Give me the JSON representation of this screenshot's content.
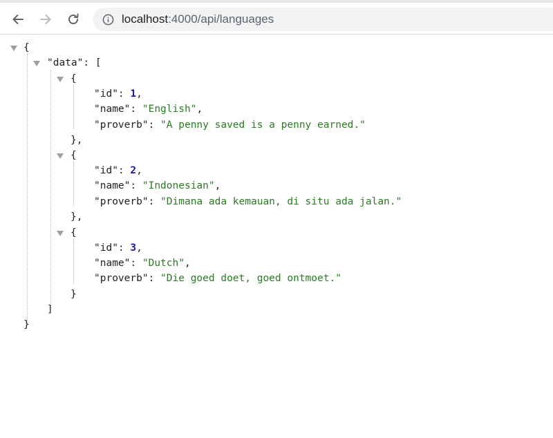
{
  "browser": {
    "url_host": "localhost",
    "url_rest": ":4000/api/languages"
  },
  "json": {
    "open_brace": "{",
    "data_key": "\"data\"",
    "data_open": ": [",
    "items": [
      {
        "id_key": "\"id\"",
        "id_value": "1",
        "name_key": "\"name\"",
        "name_value": "\"English\"",
        "proverb_key": "\"proverb\"",
        "proverb_value": "\"A penny saved is a penny earned.\""
      },
      {
        "id_key": "\"id\"",
        "id_value": "2",
        "name_key": "\"name\"",
        "name_value": "\"Indonesian\"",
        "proverb_key": "\"proverb\"",
        "proverb_value": "\"Dimana ada kemauan, di situ ada jalan.\""
      },
      {
        "id_key": "\"id\"",
        "id_value": "3",
        "name_key": "\"name\"",
        "name_value": "\"Dutch\"",
        "proverb_key": "\"proverb\"",
        "proverb_value": "\"Die goed doet, goed ontmoet.\""
      }
    ],
    "close_bracket": "]",
    "close_brace": "}"
  },
  "icons": {
    "back": "back-arrow-icon",
    "forward": "forward-arrow-icon",
    "reload": "reload-icon",
    "info": "info-icon",
    "toggle": "collapse-triangle-icon"
  }
}
